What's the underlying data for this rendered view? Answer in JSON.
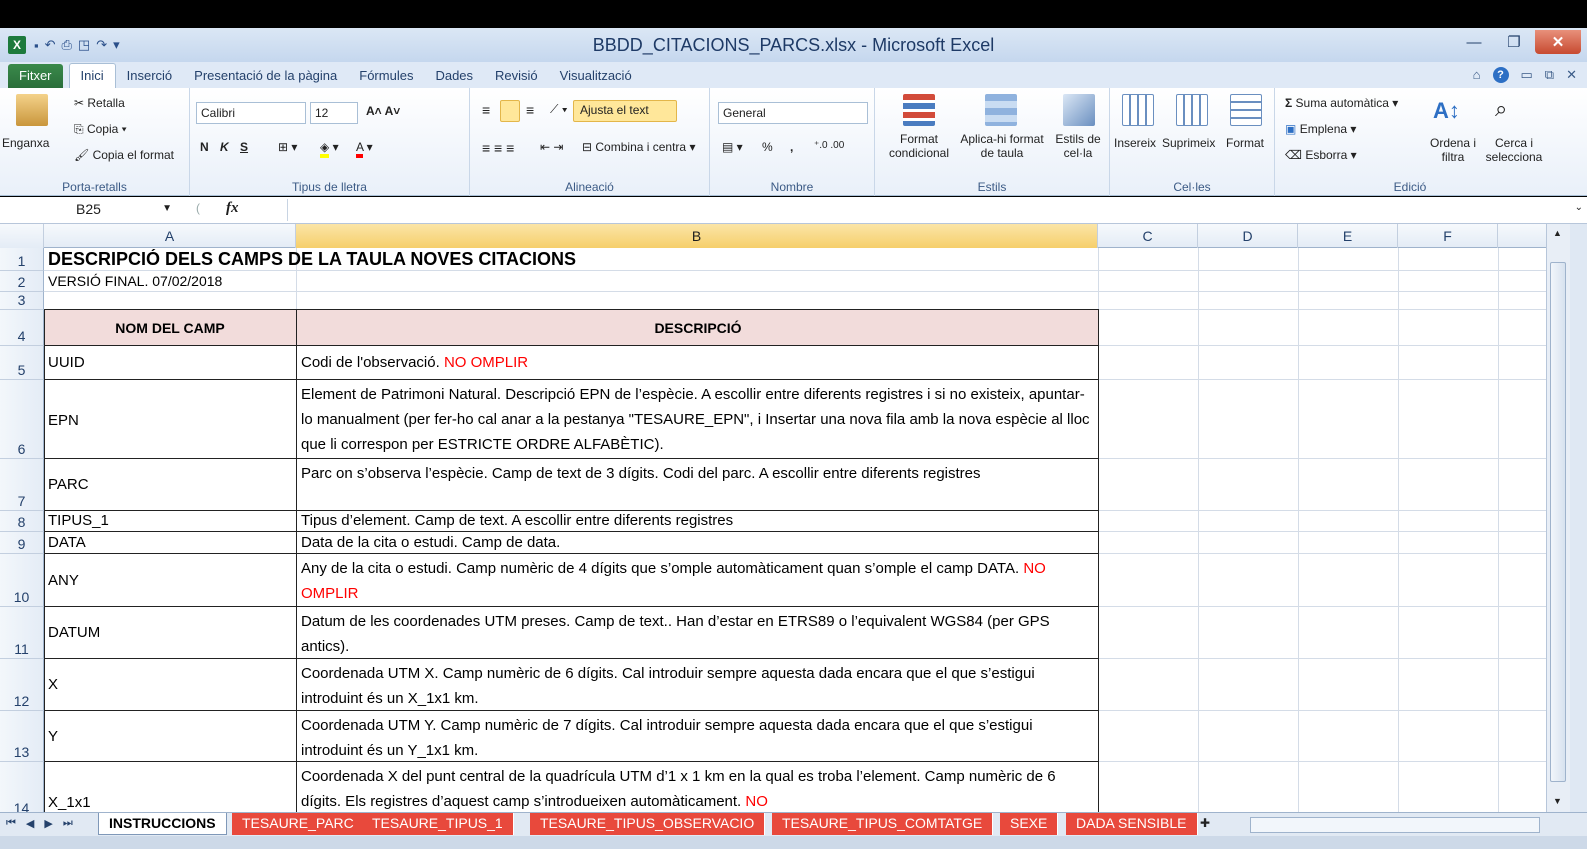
{
  "window": {
    "title": "BBDD_CITACIONS_PARCS.xlsx - Microsoft Excel",
    "minimize": "—",
    "maximize": "❐",
    "close": "✕"
  },
  "ribbon_tabs": [
    "Fitxer",
    "Inici",
    "Inserció",
    "Presentació de la pàgina",
    "Fórmules",
    "Dades",
    "Revisió",
    "Visualització"
  ],
  "ribbon": {
    "clipboard": {
      "paste": "Enganxa",
      "cut": "Retalla",
      "copy": "Copia",
      "format_painter": "Copia el format",
      "label": "Porta-retalls"
    },
    "font": {
      "name": "Calibri",
      "size": "12",
      "bold": "N",
      "italic": "K",
      "underline": "S",
      "label": "Tipus de lletra"
    },
    "alignment": {
      "wrap": "Ajusta el text",
      "merge": "Combina i centra",
      "label": "Alineació"
    },
    "number": {
      "format": "General",
      "percent": "%",
      "comma": ",",
      "label": "Nombre"
    },
    "styles": {
      "conditional": "Format condicional",
      "as_table": "Aplica-hi format de taula",
      "cell_styles": "Estils de cel·la",
      "label": "Estils"
    },
    "cells": {
      "insert": "Insereix",
      "delete": "Suprimeix",
      "format": "Format",
      "label": "Cel·les"
    },
    "editing": {
      "autosum": "Suma automàtica",
      "fill": "Emplena",
      "clear": "Esborra",
      "sort": "Ordena i filtra",
      "find": "Cerca i selecciona",
      "label": "Edició"
    }
  },
  "formula_bar": {
    "name_box": "B25",
    "fx": "fx",
    "value": ""
  },
  "columns": [
    "A",
    "B",
    "C",
    "D",
    "E",
    "F"
  ],
  "rows": [
    {
      "n": "1",
      "a": "DESCRIPCIÓ DELS CAMPS DE LA TAULA NOVES CITACIONS",
      "b": "",
      "b_red": ""
    },
    {
      "n": "2",
      "a": "VERSIÓ FINAL. 07/02/2018",
      "b": "",
      "b_red": ""
    },
    {
      "n": "3",
      "a": "",
      "b": "",
      "b_red": ""
    },
    {
      "n": "4",
      "a": "NOM DEL CAMP",
      "b": "DESCRIPCIÓ",
      "b_red": ""
    },
    {
      "n": "5",
      "a": "UUID",
      "b": "Codi de l'observació. ",
      "b_red": "NO OMPLIR"
    },
    {
      "n": "6",
      "a": "EPN",
      "b": "Element de Patrimoni Natural. Descripció EPN de l’espècie. A escollir entre diferents registres i si no existeix, apuntar-lo manualment (per fer-ho cal anar a la pestanya \"TESAURE_EPN\", i Insertar una nova fila amb la nova espècie al lloc que li correspon per ESTRICTE ORDRE ALFABÈTIC).",
      "b_red": ""
    },
    {
      "n": "7",
      "a": "PARC",
      "b": "Parc on s’observa l’espècie. Camp de text de 3 dígits. Codi del parc. A escollir entre diferents registres",
      "b_red": ""
    },
    {
      "n": "8",
      "a": "TIPUS_1",
      "b": "Tipus d’element. Camp de text. A escollir entre diferents registres",
      "b_red": ""
    },
    {
      "n": "9",
      "a": "DATA",
      "b": "Data de la cita o estudi. Camp de data.",
      "b_red": ""
    },
    {
      "n": "10",
      "a": "ANY",
      "b": "Any de la cita o estudi. Camp numèric de 4 dígits que s’omple automàticament quan s’omple el camp DATA. ",
      "b_red": "NO OMPLIR"
    },
    {
      "n": "11",
      "a": "DATUM",
      "b": "Datum de les coordenades UTM preses. Camp de text.. Han d’estar en ETRS89 o l’equivalent WGS84 (per GPS antics).",
      "b_red": ""
    },
    {
      "n": "12",
      "a": "X",
      "b": "Coordenada UTM X. Camp numèric de 6 dígits. Cal introduir sempre aquesta dada encara que el que s’estigui introduint és un X_1x1 km.",
      "b_red": ""
    },
    {
      "n": "13",
      "a": "Y",
      "b": "Coordenada UTM Y. Camp numèric de 7 dígits. Cal introduir sempre aquesta dada encara que el que s’estigui introduint és un Y_1x1 km.",
      "b_red": ""
    },
    {
      "n": "14",
      "a": "X_1x1",
      "b": "Coordenada X del punt central de la quadrícula UTM d’1 x 1 km  en la qual es troba l’element. Camp numèric de 6 dígits. Els registres d’aquest camp s’introdueixen automàticament. ",
      "b_red": "NO"
    }
  ],
  "sheet_tabs": [
    "INSTRUCCIONS",
    "TESAURE_PARC",
    "TESAURE_TIPUS_1",
    "TESAURE_TIPUS_OBSERVACIO",
    "TESAURE_TIPUS_COMTATGE",
    "SEXE",
    "DADA SENSIBLE"
  ],
  "colors": {
    "header_fill": "#f2dcdb",
    "red_text": "#ff0000",
    "sheet_tab_red": "#e8493c"
  }
}
